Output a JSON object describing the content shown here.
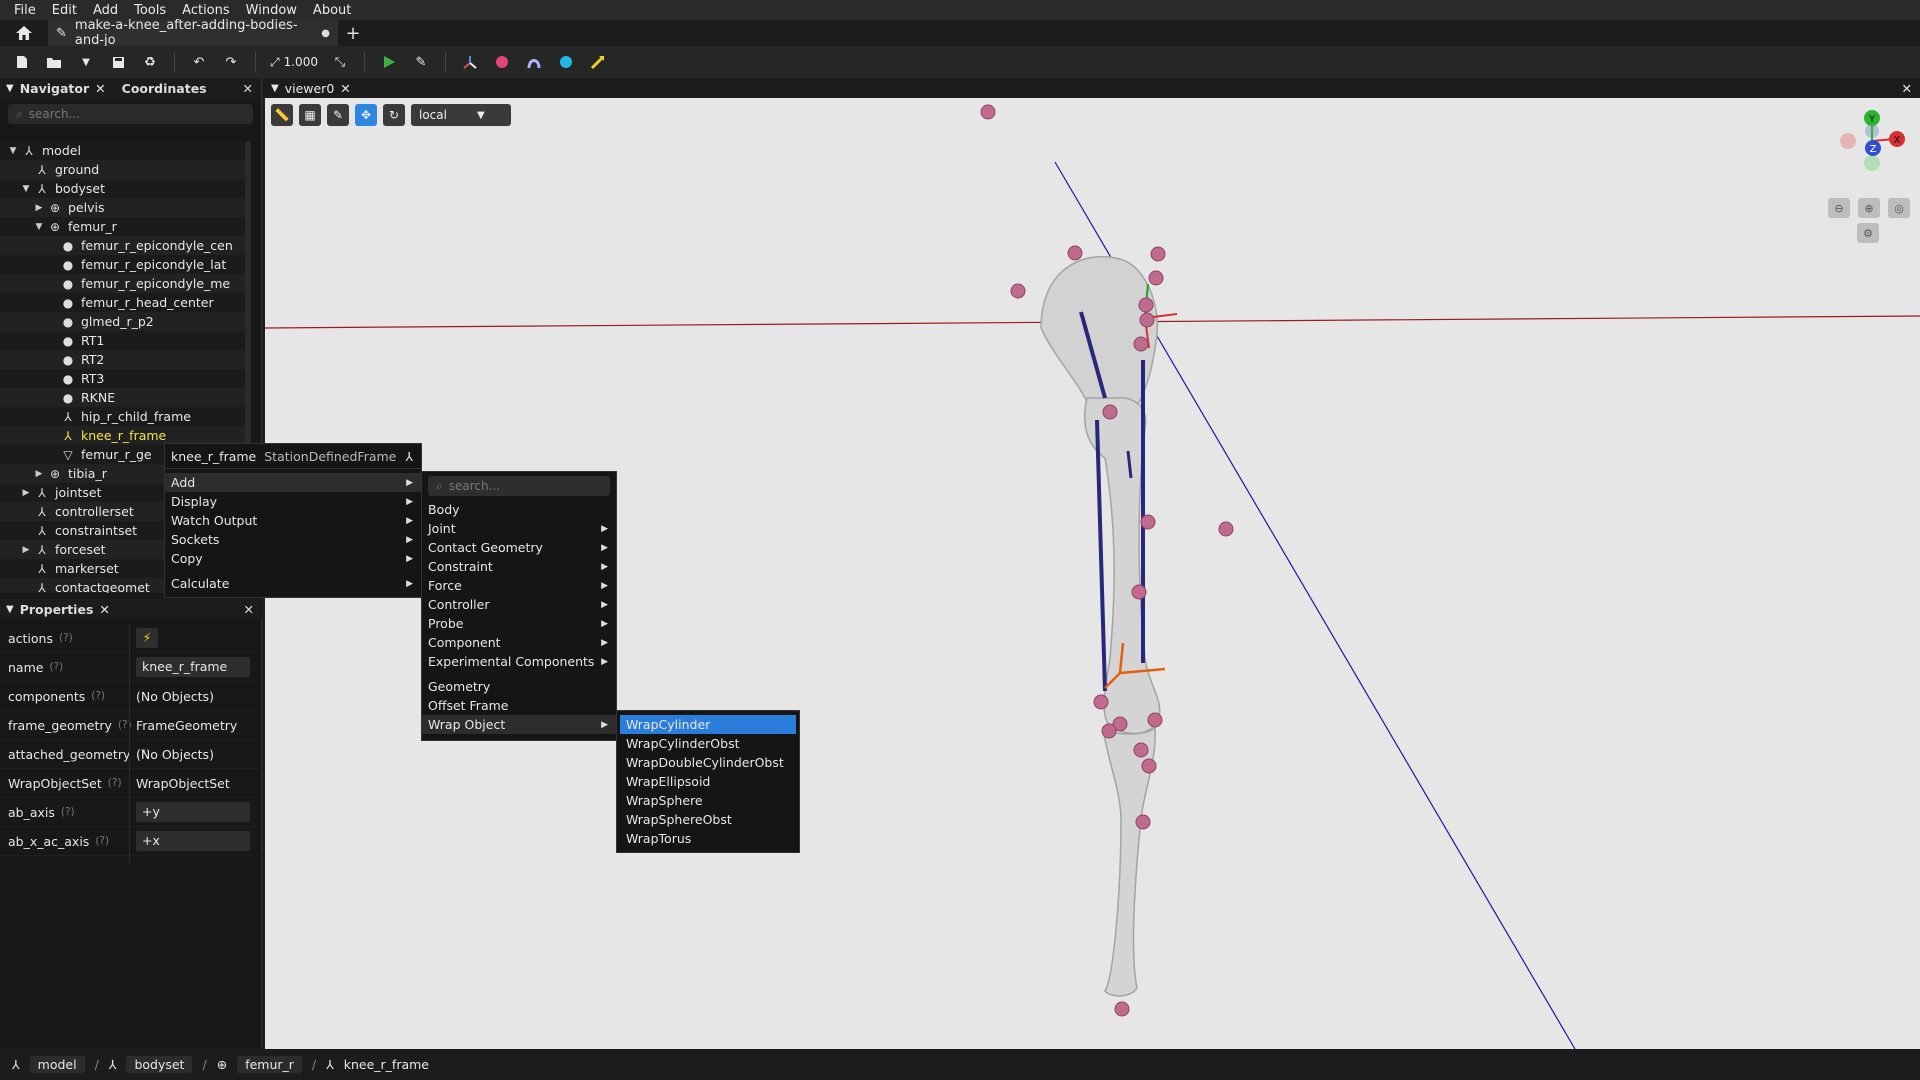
{
  "menubar": [
    "File",
    "Edit",
    "Add",
    "Tools",
    "Actions",
    "Window",
    "About"
  ],
  "tab": {
    "title": "make-a-knee_after-adding-bodies-and-jo",
    "modified_dot": "●",
    "add": "+"
  },
  "toolbar": {
    "scale_value": "1.000",
    "frame_select": "local"
  },
  "navigator": {
    "tab_label": "Navigator",
    "second_tab": "Coordinates",
    "search_placeholder": "search...",
    "tree": [
      {
        "label": "model",
        "arrow": "▼",
        "icon": "⅄",
        "indent": 0
      },
      {
        "label": "ground",
        "arrow": "",
        "icon": "⅄",
        "indent": 1
      },
      {
        "label": "bodyset",
        "arrow": "▼",
        "icon": "⅄",
        "indent": 1
      },
      {
        "label": "pelvis",
        "arrow": "▶",
        "icon": "⊕",
        "indent": 2
      },
      {
        "label": "femur_r",
        "arrow": "▼",
        "icon": "⊕",
        "indent": 2
      },
      {
        "label": "femur_r_epicondyle_cen",
        "arrow": "",
        "icon": "●",
        "indent": 3
      },
      {
        "label": "femur_r_epicondyle_lat",
        "arrow": "",
        "icon": "●",
        "indent": 3
      },
      {
        "label": "femur_r_epicondyle_me",
        "arrow": "",
        "icon": "●",
        "indent": 3
      },
      {
        "label": "femur_r_head_center",
        "arrow": "",
        "icon": "●",
        "indent": 3
      },
      {
        "label": "glmed_r_p2",
        "arrow": "",
        "icon": "●",
        "indent": 3
      },
      {
        "label": "RT1",
        "arrow": "",
        "icon": "●",
        "indent": 3
      },
      {
        "label": "RT2",
        "arrow": "",
        "icon": "●",
        "indent": 3
      },
      {
        "label": "RT3",
        "arrow": "",
        "icon": "●",
        "indent": 3
      },
      {
        "label": "RKNE",
        "arrow": "",
        "icon": "●",
        "indent": 3
      },
      {
        "label": "hip_r_child_frame",
        "arrow": "",
        "icon": "⅄",
        "indent": 3
      },
      {
        "label": "knee_r_frame",
        "arrow": "",
        "icon": "⅄",
        "indent": 3,
        "selected": true
      },
      {
        "label": "femur_r_ge",
        "arrow": "",
        "icon": "▽",
        "indent": 3
      },
      {
        "label": "tibia_r",
        "arrow": "▶",
        "icon": "⊕",
        "indent": 2
      },
      {
        "label": "jointset",
        "arrow": "▶",
        "icon": "⅄",
        "indent": 1
      },
      {
        "label": "controllerset",
        "arrow": "",
        "icon": "⅄",
        "indent": 1
      },
      {
        "label": "constraintset",
        "arrow": "",
        "icon": "⅄",
        "indent": 1
      },
      {
        "label": "forceset",
        "arrow": "▶",
        "icon": "⅄",
        "indent": 1
      },
      {
        "label": "markerset",
        "arrow": "",
        "icon": "⅄",
        "indent": 1
      },
      {
        "label": "contactgeomet",
        "arrow": "",
        "icon": "⅄",
        "indent": 1
      }
    ]
  },
  "properties": {
    "tab_label": "Properties",
    "help": "(?)",
    "rows": [
      {
        "key": "actions",
        "value": "⚡",
        "boxed": false,
        "action": true
      },
      {
        "key": "name",
        "value": "knee_r_frame",
        "boxed": true
      },
      {
        "key": "components",
        "value": "(No Objects)",
        "boxed": false
      },
      {
        "key": "frame_geometry",
        "value": "FrameGeometry",
        "boxed": false
      },
      {
        "key": "attached_geometry",
        "value": "(No Objects)",
        "boxed": false
      },
      {
        "key": "WrapObjectSet",
        "value": "WrapObjectSet",
        "boxed": false
      },
      {
        "key": "ab_axis",
        "value": "+y",
        "boxed": true
      },
      {
        "key": "ab_x_ac_axis",
        "value": "+x",
        "boxed": true
      }
    ]
  },
  "viewer": {
    "tab_label": "viewer0",
    "axis_labels": {
      "x": "X",
      "y": "Y",
      "z": "Z"
    }
  },
  "context_menu": {
    "title_name": "knee_r_frame",
    "title_class": "StationDefinedFrame",
    "items": [
      "Add",
      "Display",
      "Watch Output",
      "Sockets",
      "Copy",
      "Calculate"
    ]
  },
  "add_menu": {
    "search_placeholder": "search...",
    "items": [
      "Body",
      "Joint",
      "Contact Geometry",
      "Constraint",
      "Force",
      "Controller",
      "Probe",
      "Component",
      "Experimental Components",
      "Geometry",
      "Offset Frame",
      "Wrap Object"
    ]
  },
  "wrap_menu": {
    "items": [
      "WrapCylinder",
      "WrapCylinderObst",
      "WrapDoubleCylinderObst",
      "WrapEllipsoid",
      "WrapSphere",
      "WrapSphereObst",
      "WrapTorus"
    ]
  },
  "statusbar": {
    "crumbs": [
      "model",
      "bodyset",
      "femur_r",
      "knee_r_frame"
    ]
  },
  "colors": {
    "accent": "#2b7ddc",
    "selected_text": "#f1e14a",
    "marker": "#c06a8e",
    "muscle": "#2a2a7a"
  }
}
